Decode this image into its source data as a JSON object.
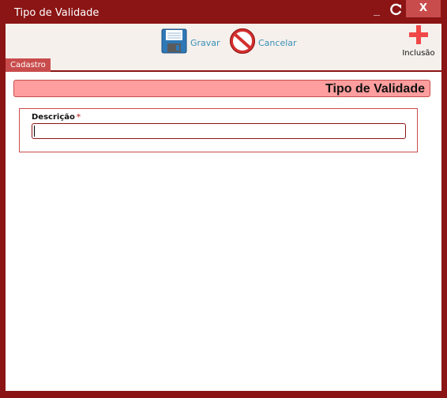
{
  "window": {
    "title": "Tipo de Validade",
    "minimize_label": "_",
    "close_label": "X"
  },
  "toolbar": {
    "save_label": "Gravar",
    "cancel_label": "Cancelar",
    "add_label": "Inclusão"
  },
  "tabs": [
    {
      "label": "Cadastro",
      "active": true
    }
  ],
  "section": {
    "title": "Tipo de Validade"
  },
  "form": {
    "descricao": {
      "label": "Descrição",
      "required_marker": "*",
      "value": "",
      "placeholder": ""
    }
  },
  "colors": {
    "frame": "#8b1414",
    "accent": "#c94c4c",
    "header_bg": "#ff9e9e",
    "toolbar_bg": "#f5f0ec",
    "link": "#3a8fb7"
  }
}
